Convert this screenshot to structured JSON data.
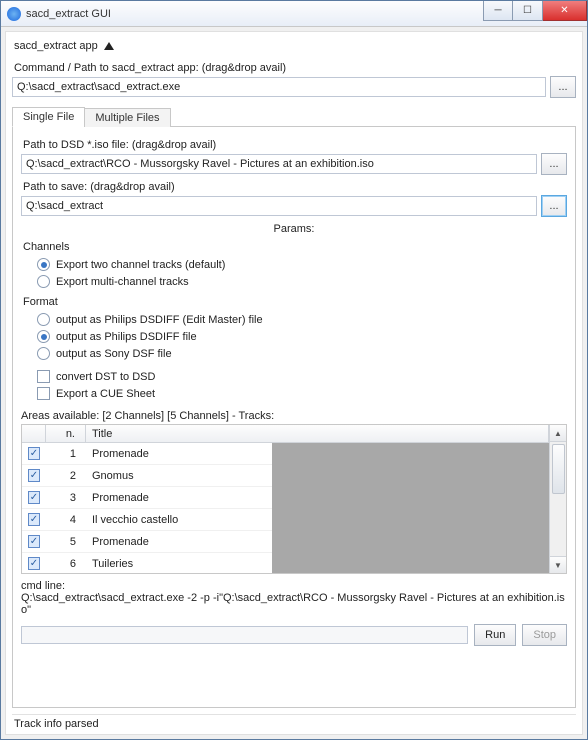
{
  "window": {
    "title": "sacd_extract GUI"
  },
  "section": {
    "app_header": "sacd_extract app"
  },
  "command": {
    "label": "Command / Path to sacd_extract app: (drag&drop avail)",
    "value": "Q:\\sacd_extract\\sacd_extract.exe",
    "browse": "..."
  },
  "tabs": {
    "single": "Single File",
    "multiple": "Multiple Files"
  },
  "iso": {
    "label": "Path to DSD *.iso file: (drag&drop avail)",
    "value": "Q:\\sacd_extract\\RCO - Mussorgsky Ravel - Pictures at an exhibition.iso",
    "browse": "..."
  },
  "save": {
    "label": "Path to save: (drag&drop avail)",
    "value": "Q:\\sacd_extract",
    "browse": "..."
  },
  "params_header": "Params:",
  "channels": {
    "title": "Channels",
    "two": "Export two channel tracks (default)",
    "multi": "Export multi-channel tracks"
  },
  "format": {
    "title": "Format",
    "dsdiff_edit": "output as Philips DSDIFF (Edit Master) file",
    "dsdiff": "output as Philips DSDIFF file",
    "dsf": "output as Sony DSF file"
  },
  "options": {
    "dst2dsd": "convert DST to DSD",
    "cue": "Export a CUE Sheet"
  },
  "areas_label": "Areas available: [2 Channels] [5 Channels] - Tracks:",
  "grid": {
    "headers": {
      "n": "n.",
      "title": "Title"
    },
    "rows": [
      {
        "n": "1",
        "title": "Promenade",
        "checked": true
      },
      {
        "n": "2",
        "title": "Gnomus",
        "checked": true
      },
      {
        "n": "3",
        "title": "Promenade",
        "checked": true
      },
      {
        "n": "4",
        "title": "Il vecchio castello",
        "checked": true
      },
      {
        "n": "5",
        "title": "Promenade",
        "checked": true
      },
      {
        "n": "6",
        "title": "Tuileries",
        "checked": true
      }
    ]
  },
  "cmdline": {
    "label": "cmd line:",
    "value": "Q:\\sacd_extract\\sacd_extract.exe -2 -p  -i\"Q:\\sacd_extract\\RCO - Mussorgsky Ravel - Pictures at an exhibition.iso\""
  },
  "buttons": {
    "run": "Run",
    "stop": "Stop"
  },
  "status": "Track info parsed"
}
